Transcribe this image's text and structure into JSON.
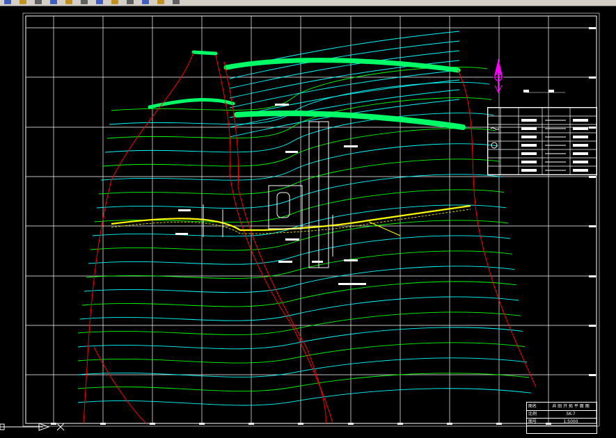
{
  "toolbar": {
    "icons": [
      "new-icon",
      "open-icon",
      "save-icon",
      "print-icon",
      "undo-icon",
      "redo-icon",
      "pan-icon",
      "zoom-icon",
      "properties-icon",
      "layer-icon",
      "match-icon",
      "help-icon"
    ]
  },
  "title_block": {
    "title": "井 田 开 拓 平 面 图",
    "title_key": "图名",
    "row2_key": "比例",
    "row2_val": "SK-7",
    "row3_key": "图号",
    "row3_val": "1:5000"
  },
  "north_arrow": {
    "color": "#ff00ff"
  },
  "colors": {
    "grid": "#ffffff",
    "contour_cyan": "#00ffff",
    "contour_green": "#00ff00",
    "boundary_red": "#ff0000",
    "fault_green": "#00ff66",
    "roadway_yellow": "#ffff00",
    "background": "#000000"
  }
}
